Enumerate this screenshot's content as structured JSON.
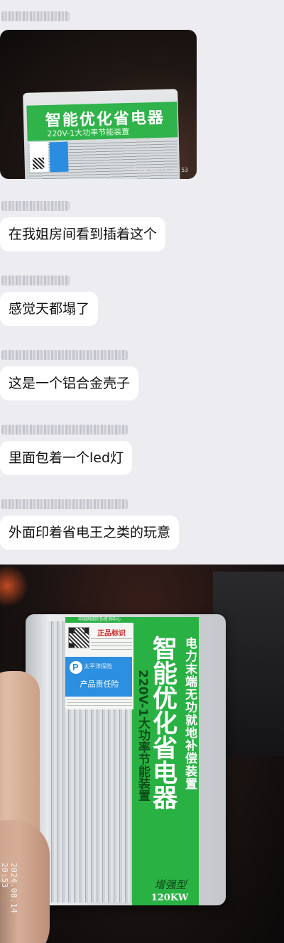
{
  "messages": [
    {
      "type": "image",
      "description_label": "thumbnail-photo",
      "timestamp": "2024.08.14  20:53"
    },
    {
      "type": "text",
      "text": "在我姐房间看到插着这个"
    },
    {
      "type": "text",
      "text": "感觉天都塌了"
    },
    {
      "type": "text",
      "text": "这是一个铝合金壳子"
    },
    {
      "type": "text",
      "text": "里面包着一个led灯"
    },
    {
      "type": "text",
      "text": "外面印着省电王之类的玩意"
    },
    {
      "type": "image",
      "timestamp": "2024.08.14  20:53"
    }
  ],
  "photo_text": {
    "title": "智能优化省电器",
    "subtitle": "电力末端无功就地补偿装置",
    "voltage": "220V-1大功率节能装置",
    "model": "增强型",
    "power": "120KW",
    "label_header": "中国网络防伪查询中心",
    "genuine": "正品标识",
    "insurer": "太平洋保险",
    "insurance": "产品责任险"
  },
  "colors": {
    "background": "#ececf1",
    "bubble": "#ffffff",
    "device_green": "#2ab143"
  }
}
